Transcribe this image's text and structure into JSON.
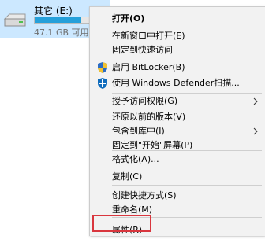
{
  "drive": {
    "name": "其它 (E:)",
    "free_text": "47.1 GB 可用，共",
    "usage_fraction": 0.6,
    "icon": "drive-icon",
    "selected_color": "#cce8ff",
    "bar_color": "#26a0da"
  },
  "menu": {
    "items": [
      {
        "label": "打开(O)",
        "bold": true
      },
      {
        "label": "在新窗口中打开(E)"
      },
      {
        "label": "固定到快速访问"
      },
      {
        "label": "启用 BitLocker(B)",
        "icon": "shield-icon"
      },
      {
        "label": "使用 Windows Defender扫描...",
        "icon": "defender-icon"
      },
      {
        "label": "授予访问权限(G)",
        "submenu": true
      },
      {
        "label": "还原以前的版本(V)"
      },
      {
        "label": "包含到库中(I)",
        "submenu": true
      },
      {
        "label": "固定到\"开始\"屏幕(P)"
      },
      {
        "label": "格式化(A)..."
      },
      {
        "label": "复制(C)"
      },
      {
        "label": "创建快捷方式(S)"
      },
      {
        "label": "重命名(M)"
      },
      {
        "label": "属性(R)",
        "highlighted": true
      }
    ],
    "highlight_color": "#d9363e"
  }
}
